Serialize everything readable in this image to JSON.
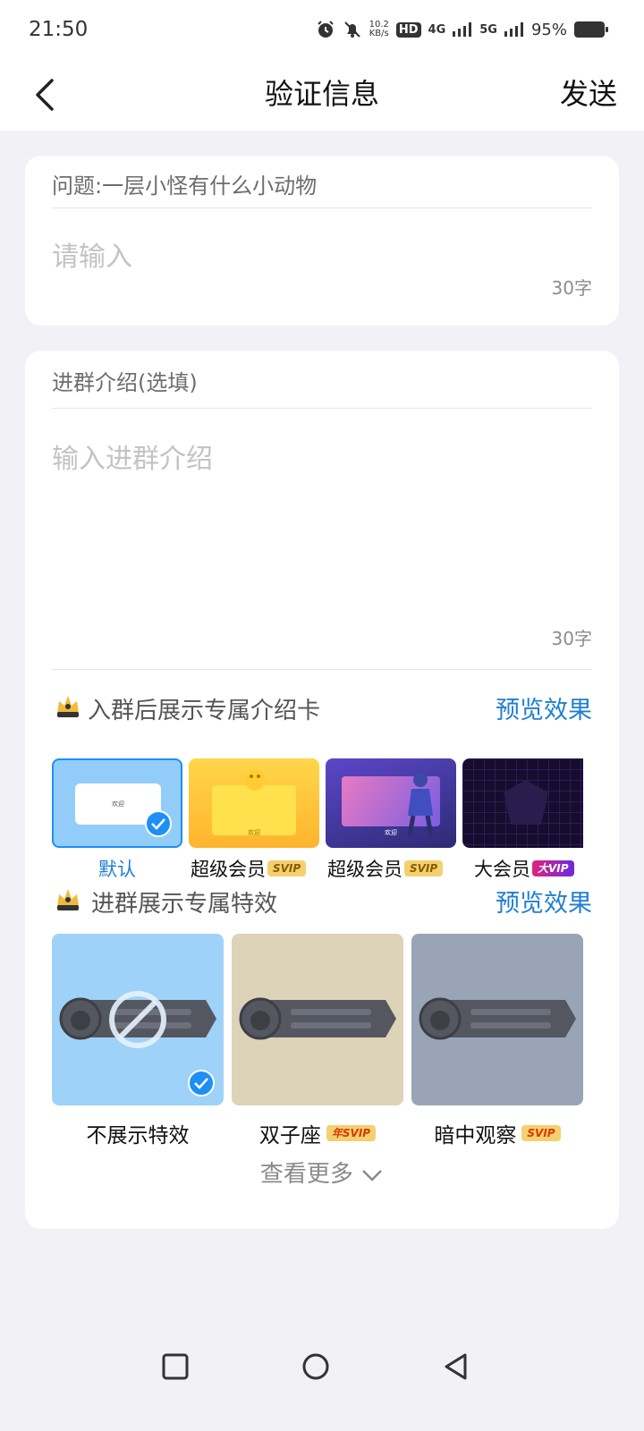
{
  "status_bar": {
    "time": "21:50",
    "net_speed_top": "10.2",
    "net_speed_bottom": "KB/s",
    "hd": "HD",
    "sim1": "4G",
    "sim2": "5G",
    "battery": "95%"
  },
  "nav": {
    "title": "验证信息",
    "send_label": "发送"
  },
  "question_card": {
    "question": "问题:一层小怪有什么小动物",
    "answer_placeholder": "请输入",
    "counter": "30字"
  },
  "intro_card": {
    "label": "进群介绍(选填)",
    "placeholder": "输入进群介绍",
    "counter": "30字",
    "intro_card_section": {
      "title": "入群后展示专属介绍卡",
      "preview_label": "预览效果",
      "cards": [
        {
          "label": "默认",
          "badge": "",
          "selected": true,
          "preview_text": "欢迎"
        },
        {
          "label": "超级会员",
          "badge": "SVIP",
          "selected": false,
          "preview_text": "欢迎"
        },
        {
          "label": "超级会员",
          "badge": "SVIP",
          "selected": false,
          "preview_text": "欢迎"
        },
        {
          "label": "大会员",
          "badge": "大VIP",
          "selected": false,
          "preview_text": ""
        }
      ]
    },
    "effect_section": {
      "title": "进群展示专属特效",
      "preview_label": "预览效果",
      "effects": [
        {
          "label": "不展示特效",
          "badge": "",
          "selected": true,
          "color": "#9fd2f9"
        },
        {
          "label": "双子座",
          "badge": "年SVIP",
          "selected": false,
          "color": "#ddd3b9"
        },
        {
          "label": "暗中观察",
          "badge": "SVIP",
          "selected": false,
          "color": "#99a5b6"
        }
      ]
    },
    "more_label": "查看更多"
  },
  "colors": {
    "accent": "#1f7fd1",
    "background": "#f1f1f6",
    "check": "#1e8ff5"
  }
}
